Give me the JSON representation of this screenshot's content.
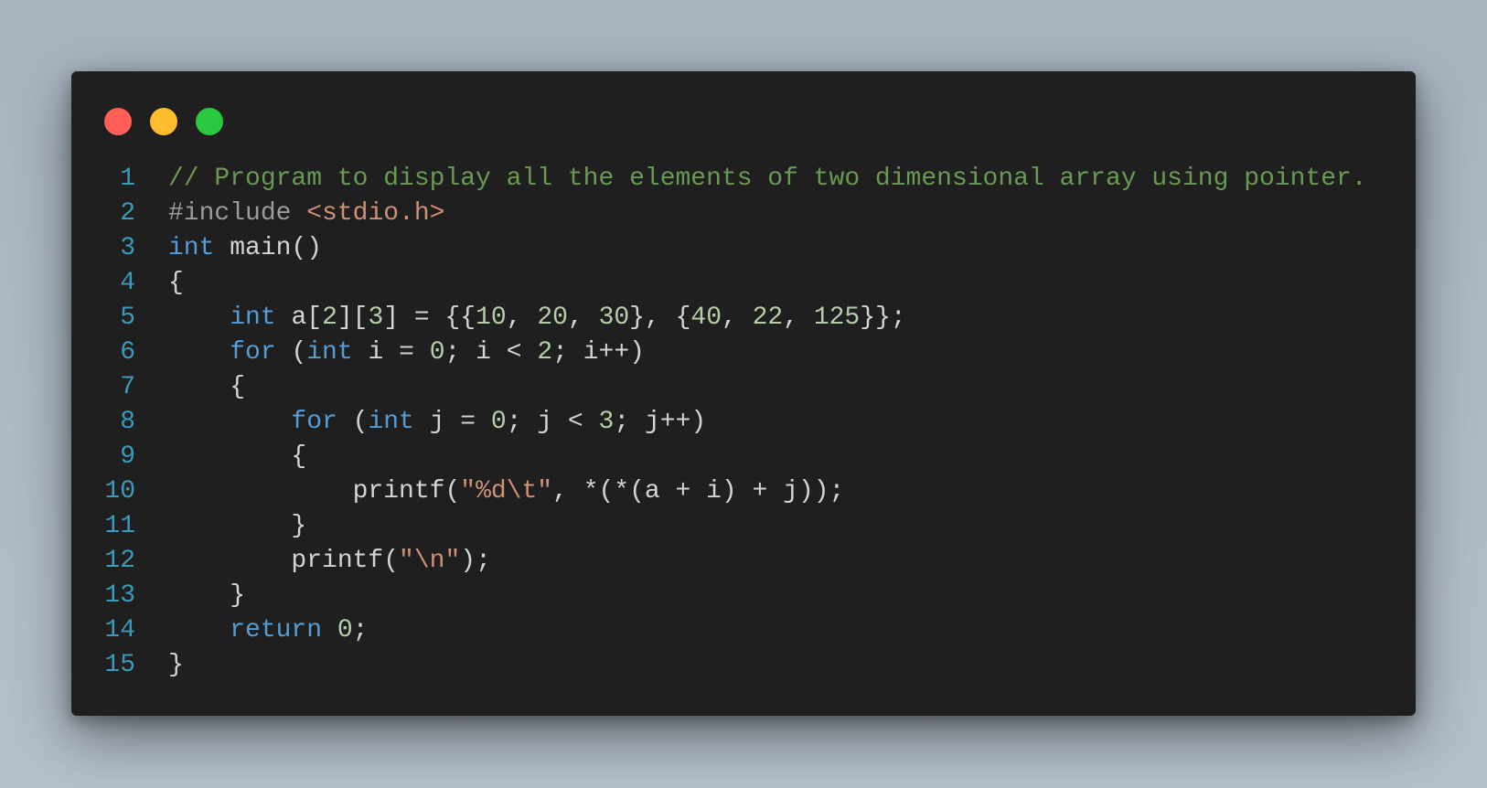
{
  "window": {
    "controls": [
      {
        "name": "close",
        "color": "#ff5f57"
      },
      {
        "name": "minimize",
        "color": "#febc2e"
      },
      {
        "name": "maximize",
        "color": "#28c840"
      }
    ]
  },
  "colors": {
    "comment": "#6a9955",
    "keyword": "#569cd6",
    "string": "#ce9178",
    "number": "#b5cea8",
    "preprocessor": "#9b9b9b",
    "default": "#d4d4d4",
    "line_number": "#3a9bbd"
  },
  "code": {
    "language": "c",
    "lines": [
      {
        "n": "1",
        "tokens": [
          {
            "t": "// Program to display all the elements of two dimensional array using pointer.",
            "k": "comment"
          }
        ]
      },
      {
        "n": "2",
        "tokens": [
          {
            "t": "#include ",
            "k": "preprocessor"
          },
          {
            "t": "<stdio.h>",
            "k": "string"
          }
        ]
      },
      {
        "n": "3",
        "tokens": [
          {
            "t": "int",
            "k": "keyword"
          },
          {
            "t": " main()",
            "k": "default"
          }
        ]
      },
      {
        "n": "4",
        "tokens": [
          {
            "t": "{",
            "k": "default"
          }
        ]
      },
      {
        "n": "5",
        "tokens": [
          {
            "t": "    ",
            "k": "default"
          },
          {
            "t": "int",
            "k": "keyword"
          },
          {
            "t": " a[",
            "k": "default"
          },
          {
            "t": "2",
            "k": "number"
          },
          {
            "t": "][",
            "k": "default"
          },
          {
            "t": "3",
            "k": "number"
          },
          {
            "t": "] = {{",
            "k": "default"
          },
          {
            "t": "10",
            "k": "number"
          },
          {
            "t": ", ",
            "k": "default"
          },
          {
            "t": "20",
            "k": "number"
          },
          {
            "t": ", ",
            "k": "default"
          },
          {
            "t": "30",
            "k": "number"
          },
          {
            "t": "}, {",
            "k": "default"
          },
          {
            "t": "40",
            "k": "number"
          },
          {
            "t": ", ",
            "k": "default"
          },
          {
            "t": "22",
            "k": "number"
          },
          {
            "t": ", ",
            "k": "default"
          },
          {
            "t": "125",
            "k": "number"
          },
          {
            "t": "}};",
            "k": "default"
          }
        ]
      },
      {
        "n": "6",
        "tokens": [
          {
            "t": "    ",
            "k": "default"
          },
          {
            "t": "for",
            "k": "keyword"
          },
          {
            "t": " (",
            "k": "default"
          },
          {
            "t": "int",
            "k": "keyword"
          },
          {
            "t": " i = ",
            "k": "default"
          },
          {
            "t": "0",
            "k": "number"
          },
          {
            "t": "; i < ",
            "k": "default"
          },
          {
            "t": "2",
            "k": "number"
          },
          {
            "t": "; i++)",
            "k": "default"
          }
        ]
      },
      {
        "n": "7",
        "tokens": [
          {
            "t": "    {",
            "k": "default"
          }
        ]
      },
      {
        "n": "8",
        "tokens": [
          {
            "t": "        ",
            "k": "default"
          },
          {
            "t": "for",
            "k": "keyword"
          },
          {
            "t": " (",
            "k": "default"
          },
          {
            "t": "int",
            "k": "keyword"
          },
          {
            "t": " j = ",
            "k": "default"
          },
          {
            "t": "0",
            "k": "number"
          },
          {
            "t": "; j < ",
            "k": "default"
          },
          {
            "t": "3",
            "k": "number"
          },
          {
            "t": "; j++)",
            "k": "default"
          }
        ]
      },
      {
        "n": "9",
        "tokens": [
          {
            "t": "        {",
            "k": "default"
          }
        ]
      },
      {
        "n": "10",
        "tokens": [
          {
            "t": "            printf(",
            "k": "default"
          },
          {
            "t": "\"%d\\t\"",
            "k": "string"
          },
          {
            "t": ", *(*(a + i) + j));",
            "k": "default"
          }
        ]
      },
      {
        "n": "11",
        "tokens": [
          {
            "t": "        }",
            "k": "default"
          }
        ]
      },
      {
        "n": "12",
        "tokens": [
          {
            "t": "        printf(",
            "k": "default"
          },
          {
            "t": "\"\\n\"",
            "k": "string"
          },
          {
            "t": ");",
            "k": "default"
          }
        ]
      },
      {
        "n": "13",
        "tokens": [
          {
            "t": "    }",
            "k": "default"
          }
        ]
      },
      {
        "n": "14",
        "tokens": [
          {
            "t": "    ",
            "k": "default"
          },
          {
            "t": "return",
            "k": "keyword"
          },
          {
            "t": " ",
            "k": "default"
          },
          {
            "t": "0",
            "k": "number"
          },
          {
            "t": ";",
            "k": "default"
          }
        ]
      },
      {
        "n": "15",
        "tokens": [
          {
            "t": "}",
            "k": "default"
          }
        ]
      }
    ]
  }
}
